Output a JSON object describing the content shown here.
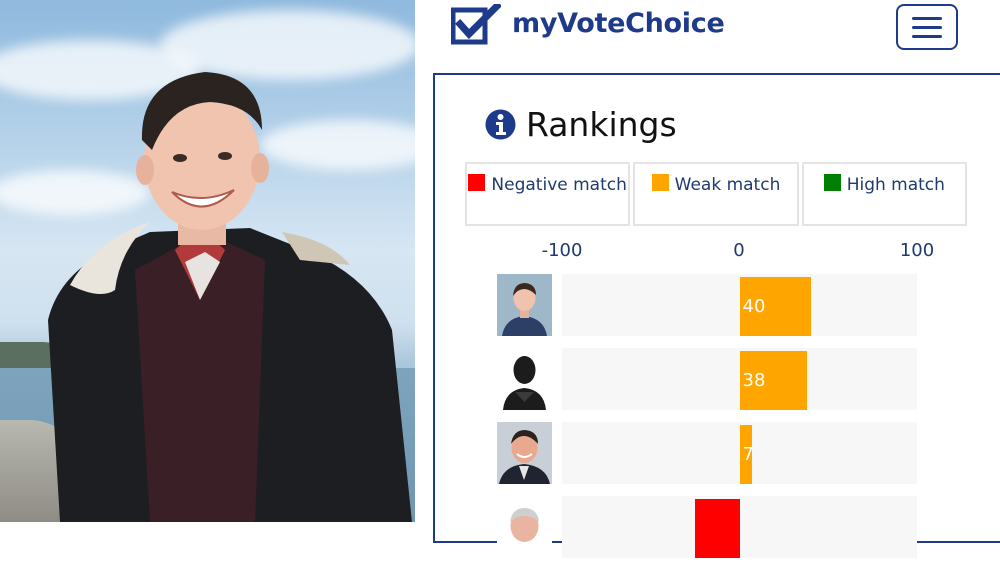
{
  "brand": {
    "name": "myVoteChoice"
  },
  "menu": {
    "icon": "hamburger-menu-icon"
  },
  "rankings": {
    "title": "Rankings",
    "icon": "info-icon",
    "legend": [
      {
        "label": "Negative match",
        "color": "#ff0000"
      },
      {
        "label": "Weak match",
        "color": "#ffa500"
      },
      {
        "label": "High match",
        "color": "#008000"
      }
    ],
    "axis": [
      "-100",
      "0",
      "100"
    ],
    "axis_range": [
      -100,
      100
    ],
    "candidates": [
      {
        "avatar": "candidate-photo-young-man",
        "value": 40,
        "label": "40",
        "color": "#ffa500"
      },
      {
        "avatar": "anonymous-silhouette",
        "value": 38,
        "label": "38",
        "color": "#ffa500"
      },
      {
        "avatar": "candidate-photo-man-suit",
        "value": 7,
        "label": "7",
        "color": "#ffa500"
      },
      {
        "avatar": "candidate-photo-older-man",
        "value": -25,
        "label": "",
        "color": "#ff0000"
      }
    ]
  }
}
